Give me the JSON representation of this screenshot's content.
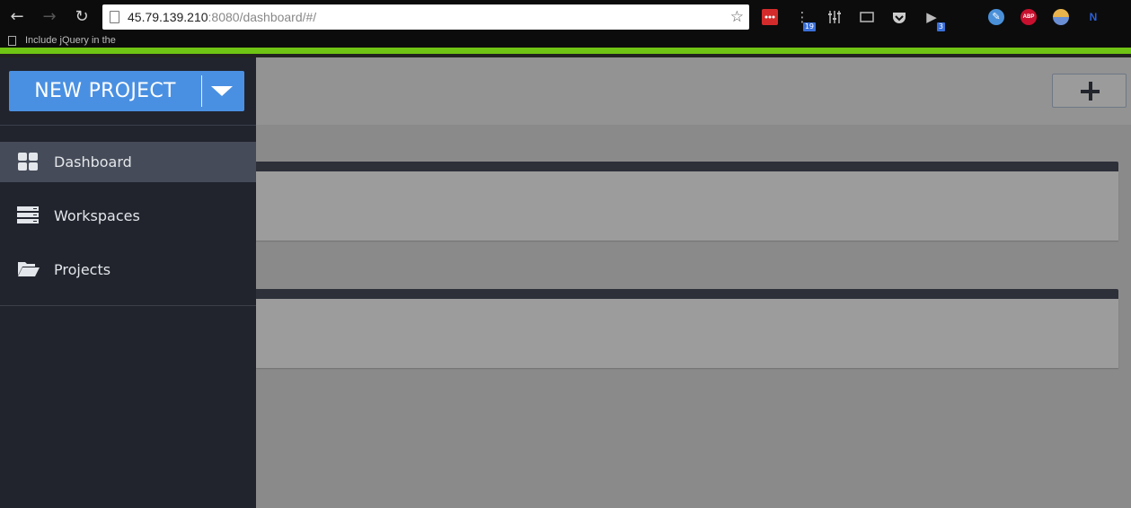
{
  "browser": {
    "url_host": "45.79.139.210",
    "url_rest": ":8080/dashboard/#/",
    "bookmark_label": "Include jQuery in the",
    "extensions": [
      {
        "name": "lastpass-icon"
      },
      {
        "name": "tab-counter-icon",
        "badge": "19"
      },
      {
        "name": "equalizer-icon"
      },
      {
        "name": "cast-icon"
      },
      {
        "name": "pocket-icon"
      },
      {
        "name": "audio-icon",
        "badge": "3"
      },
      {
        "name": "blue-circle-icon"
      },
      {
        "name": "abp-icon",
        "label": "ABP"
      },
      {
        "name": "yellow-circle-icon"
      },
      {
        "name": "n-icon",
        "label": "N"
      }
    ],
    "loading_color": "#70c414"
  },
  "sidebar": {
    "new_project_label": "NEW PROJECT",
    "items": [
      {
        "label": "Dashboard",
        "icon": "grid-icon",
        "active": true
      },
      {
        "label": "Workspaces",
        "icon": "server-stack-icon",
        "active": false
      },
      {
        "label": "Projects",
        "icon": "folder-open-icon",
        "active": false
      }
    ]
  },
  "colors": {
    "accent": "#4a90e2",
    "sidebar_bg": "#21242d",
    "sidebar_active": "#454b58",
    "panel_bar": "#2d3039"
  }
}
